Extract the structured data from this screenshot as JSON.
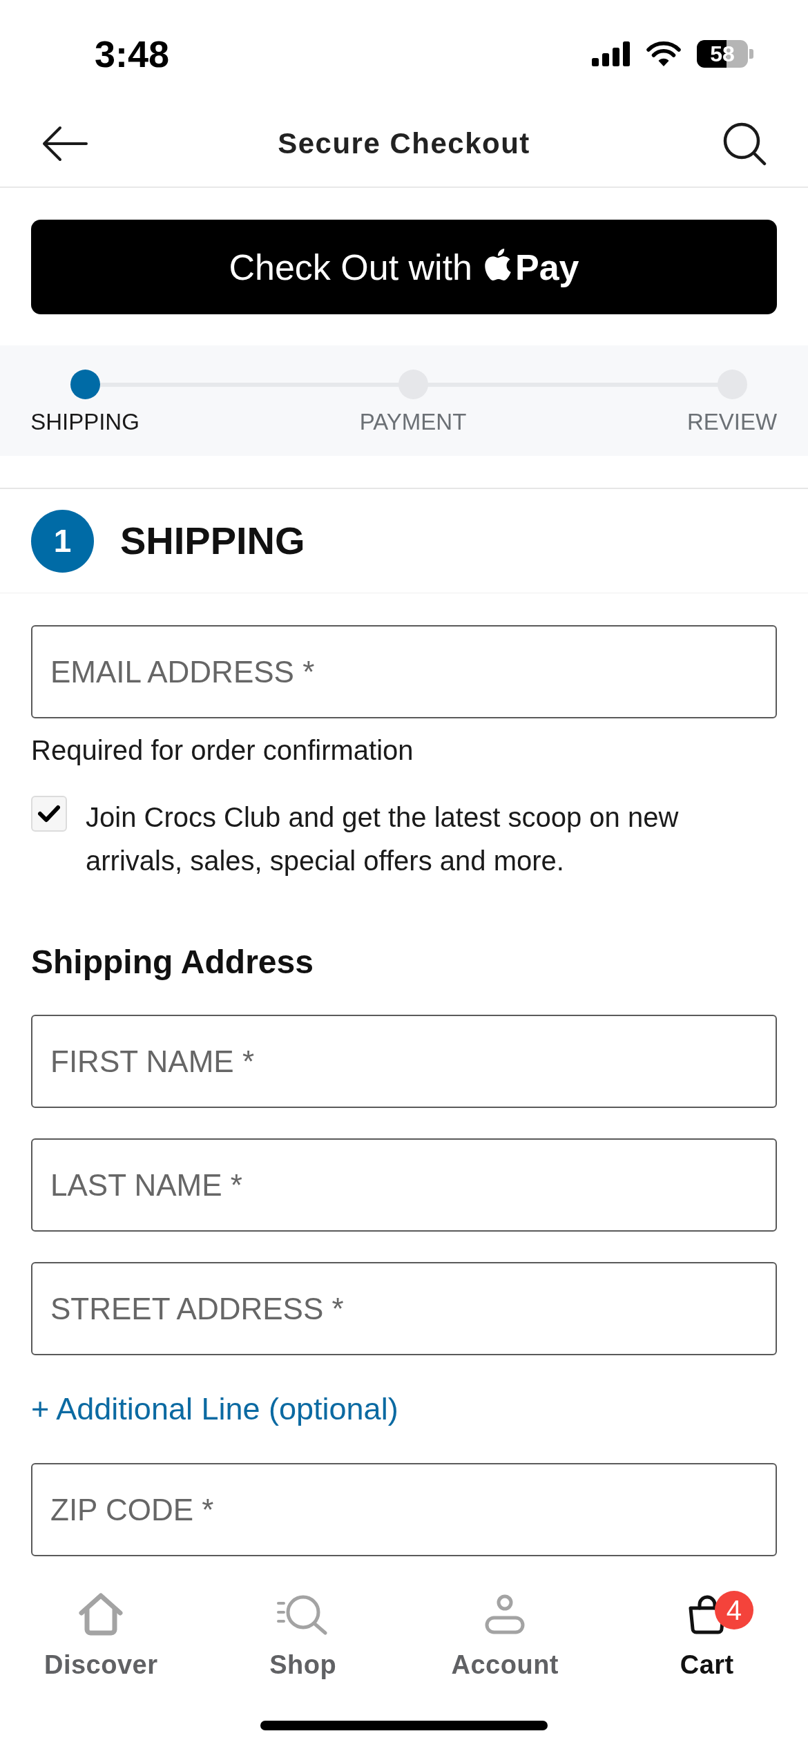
{
  "status_bar": {
    "time": "3:48",
    "battery": "58"
  },
  "header": {
    "title": "Secure Checkout"
  },
  "express_checkout": {
    "label": "Check Out with",
    "brand": "Pay"
  },
  "steps": [
    {
      "label": "SHIPPING",
      "selected": true
    },
    {
      "label": "PAYMENT",
      "selected": false
    },
    {
      "label": "REVIEW",
      "selected": false
    }
  ],
  "section": {
    "number": "1",
    "title": "SHIPPING"
  },
  "email": {
    "placeholder": "EMAIL ADDRESS *",
    "hint": "Required for order confirmation"
  },
  "newsletter": {
    "label": "Join Crocs Club and get the latest scoop on new arrivals, sales, special offers and more.",
    "checked": true
  },
  "shipping_address": {
    "title": "Shipping Address",
    "items": [
      {
        "kind": "field",
        "placeholder": "FIRST NAME *"
      },
      {
        "kind": "field",
        "placeholder": "LAST NAME *"
      },
      {
        "kind": "field",
        "placeholder": "STREET ADDRESS *"
      },
      {
        "kind": "link",
        "label": "+ Additional Line (optional)"
      },
      {
        "kind": "field",
        "placeholder": "ZIP CODE *"
      }
    ]
  },
  "bottom_nav": [
    {
      "label": "Discover",
      "selected": false
    },
    {
      "label": "Shop",
      "selected": false
    },
    {
      "label": "Account",
      "selected": false
    },
    {
      "label": "Cart",
      "selected": true,
      "badge": "4"
    }
  ]
}
